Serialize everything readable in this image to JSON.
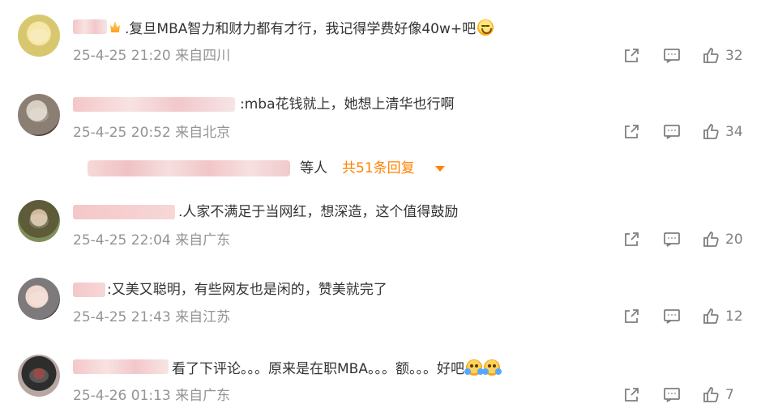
{
  "comments": [
    {
      "text": ".复旦MBA智力和财力都有才行，我记得学费好像40w+吧",
      "meta": "25-4-25 21:20 来自四川",
      "likes": "32",
      "emoji": "laugh"
    },
    {
      "text": ":mba花钱就上，她想上清华也行啊",
      "meta": "25-4-25 20:52 来自北京",
      "likes": "34",
      "reply_text": "等人",
      "reply_link": "共51条回复"
    },
    {
      "text": ".人家不满足于当网红，想深造，这个值得鼓励",
      "meta": "25-4-25 22:04 来自广东",
      "likes": "20"
    },
    {
      "text": ":又美又聪明，有些网友也是闲的，赞美就完了",
      "meta": "25-4-25 21:43 来自江苏",
      "likes": "12"
    },
    {
      "text": "看了下评论。。。原来是在职MBA。。。额。。。好吧",
      "meta": "25-4-26 01:13 来自广东",
      "likes": "7",
      "emoji": "hug"
    }
  ],
  "colors": {
    "text": "#333333",
    "meta": "#949494",
    "accent": "#ff8200",
    "icon": "#808080"
  },
  "icons": {
    "share": "share-icon",
    "comment": "comment-icon",
    "like": "thumbs-up-icon"
  }
}
